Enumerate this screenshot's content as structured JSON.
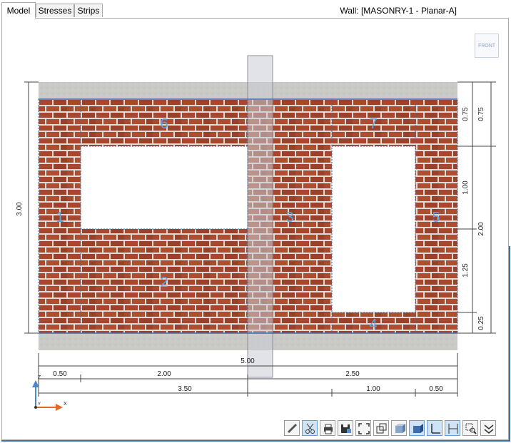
{
  "tabs": [
    {
      "label": "Model",
      "active": true
    },
    {
      "label": "Stresses",
      "active": false
    },
    {
      "label": "Strips",
      "active": false
    }
  ],
  "wall_title": "Wall: [MASONRY-1 - Planar-A]",
  "view_cube_label": "FRONT",
  "wall": {
    "overall_height": "3.00",
    "overall_width": "5.00",
    "regions": [
      "1",
      "2",
      "3",
      "4",
      "5",
      "6",
      "7"
    ]
  },
  "dimensions": {
    "right_inner": [
      "0.75",
      "1.00",
      "1.25",
      "0.25"
    ],
    "right_outer": [
      "0.75",
      "2.00"
    ],
    "bottom_row1": [
      "0.50",
      "2.00",
      "2.50"
    ],
    "bottom_row2": [
      "3.50",
      "1.00",
      "0.50"
    ]
  },
  "axes": {
    "z": "Z",
    "y": "Y",
    "x": "X"
  },
  "toolbar": [
    {
      "name": "measure-icon",
      "active": false
    },
    {
      "name": "cut-icon",
      "active": true
    },
    {
      "name": "print-icon",
      "active": false
    },
    {
      "name": "save-image-icon",
      "active": false
    },
    {
      "name": "zoom-extents-icon",
      "active": false
    },
    {
      "name": "wireframe-icon",
      "active": false
    },
    {
      "name": "solid-icon",
      "active": false
    },
    {
      "name": "shaded-icon",
      "active": true
    },
    {
      "name": "axes-icon",
      "active": true
    },
    {
      "name": "dimensions-icon",
      "active": true
    },
    {
      "name": "zoom-window-icon",
      "active": false
    },
    {
      "name": "more-icon",
      "active": false
    }
  ],
  "colors": {
    "accent": "#3a6fb0",
    "brick": "#a54a2e",
    "mortar": "#dcdcdc",
    "concrete": "#c9c9c6"
  }
}
